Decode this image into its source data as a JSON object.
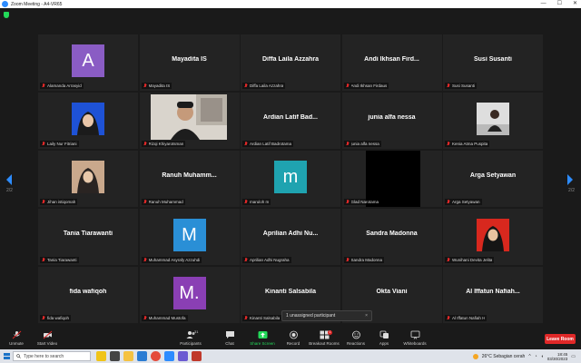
{
  "window": {
    "title": "Zoom Meeting - A4-VR65"
  },
  "pager": {
    "left": "2/2",
    "right": "2/2"
  },
  "tiles": [
    {
      "kind": "avatar",
      "letter": "A",
      "color": "#8a5cc4",
      "label": "Alamanda Arrasyid"
    },
    {
      "kind": "name",
      "bigname": "Mayadita IS",
      "label": "Mayadita IS"
    },
    {
      "kind": "name",
      "bigname": "Diffa Laila Azzahra",
      "label": "Diffa Laila Azzahra"
    },
    {
      "kind": "name",
      "bigname": "Andi Ikhsan Fird...",
      "label": "Andi Ikhsan Firdaus"
    },
    {
      "kind": "name",
      "bigname": "Susi Susanti",
      "label": "Susi Susanti"
    },
    {
      "kind": "photo",
      "photo": "hijab-blue",
      "label": "Laily Nur Fitriani"
    },
    {
      "kind": "camera",
      "label": "Rizqi Khiyarotsman"
    },
    {
      "kind": "name",
      "bigname": "Ardian Latif Bad...",
      "label": "Ardian Latif Badrotama"
    },
    {
      "kind": "name",
      "bigname": "junia alfa nessa",
      "label": "junia alfa nessa"
    },
    {
      "kind": "photo",
      "photo": "woman-desk",
      "label": "Kenia Atma Puspita"
    },
    {
      "kind": "photo",
      "photo": "hijab-brown",
      "label": "Jihan istiqomah"
    },
    {
      "kind": "name",
      "bigname": "Ranuh Muhamm...",
      "label": "Ranuh Muhammad"
    },
    {
      "kind": "avatar",
      "letter": "m",
      "color": "#1fa3b0",
      "label": "maruloh m"
    },
    {
      "kind": "black",
      "label": "Glad Narotama"
    },
    {
      "kind": "name",
      "bigname": "Arga Setyawan",
      "label": "Arga Setyawan"
    },
    {
      "kind": "name",
      "bigname": "Tania Tiarawanti",
      "label": "Tania Tiarawanti"
    },
    {
      "kind": "avatar",
      "letter": "M",
      "color": "#2a8fd6",
      "label": "Muhammad Asyrafy Azzuhdi"
    },
    {
      "kind": "name",
      "bigname": "Aprilian Adhi Nu...",
      "label": "Aprilian Adhi Nugraha"
    },
    {
      "kind": "name",
      "bigname": "Sandra Madonna",
      "label": "Sandra Madonna"
    },
    {
      "kind": "photo",
      "photo": "hijab-red",
      "label": "Wunihani Devita Jelita"
    },
    {
      "kind": "name",
      "bigname": "fida wafiqoh",
      "label": "fida wafiqoh"
    },
    {
      "kind": "avatar",
      "letter": "M.",
      "color": "#8a3fb4",
      "label": "Muhammad Mustofa"
    },
    {
      "kind": "name",
      "bigname": "Kinanti Salsabila",
      "label": "Kinanti Salsabila"
    },
    {
      "kind": "name",
      "bigname": "Okta Viani",
      "label": ""
    },
    {
      "kind": "name",
      "bigname": "Al Iffatun Nafiah...",
      "label": "Al Iffatun Nafiah H"
    }
  ],
  "unassigned": {
    "text": "1 unassigned participant",
    "close": "×"
  },
  "toolbar": {
    "unmute": "Unmute",
    "start_video": "Start Video",
    "participants": "Participants",
    "participants_count": "31",
    "chat": "Chat",
    "share_screen": "Share Screen",
    "record": "Record",
    "breakout": "Breakout Rooms",
    "breakout_badge": "1",
    "reactions": "Reactions",
    "apps": "Apps",
    "whiteboards": "Whiteboards",
    "leave": "Leave Room"
  },
  "taskbar": {
    "search_placeholder": "Type here to search",
    "weather": "26°C  Sebagian cerah",
    "time": "18:45",
    "date": "03/30/2023"
  },
  "colors": {
    "share_green": "#23d959",
    "mute_red": "#e02828",
    "leave_red": "#e02828"
  }
}
